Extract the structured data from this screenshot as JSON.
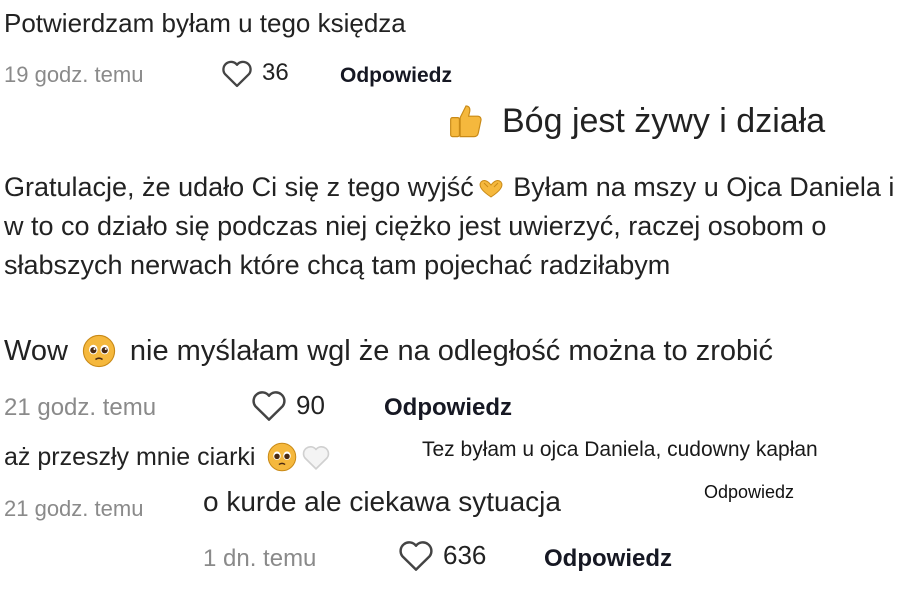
{
  "comment1": {
    "text": "Potwierdzam byłam u tego księdza",
    "time": "19 godz. temu",
    "likes": "36",
    "reply": "Odpowiedz"
  },
  "pinned": {
    "text": "Bóg jest żywy i działa",
    "emoji": "thumbs-up-icon"
  },
  "comment2": {
    "text_part1": "Gratulacje, że udało Ci się z tego wyjść",
    "text_part2": " Byłam na mszy u Ojca Daniela i w to co działo się podczas niej ciężko jest uwierzyć, raczej osobom o słabszych nerwach które chcą tam pojechać radziłabym",
    "emoji": "heart-hands-icon"
  },
  "comment3": {
    "text_part1": "Wow",
    "text_part2": "nie myślałam wgl że na odległość można to zrobić",
    "time": "21 godz. temu",
    "likes": "90",
    "reply": "Odpowiedz",
    "emoji": "pleading-face-icon"
  },
  "comment4": {
    "text": "aż przeszły mnie ciarki",
    "time": "21 godz. temu",
    "emoji": "pleading-face-icon"
  },
  "comment5": {
    "text": "Tez byłam u ojca Daniela, cudowny kapłan",
    "reply": "Odpowiedz"
  },
  "comment6": {
    "text": "o kurde ale ciekawa sytuacja",
    "time": "1 dn. temu",
    "likes": "636",
    "reply": "Odpowiedz"
  },
  "colors": {
    "text": "#222222",
    "meta": "#8a8a8a",
    "reply": "#161823",
    "emoji_yellow": "#f5b83d"
  }
}
